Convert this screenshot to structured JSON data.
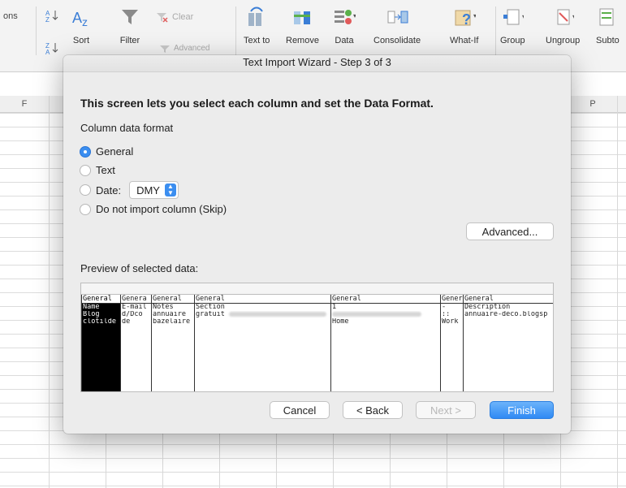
{
  "ribbon": {
    "cut_label": "ons",
    "items": [
      {
        "name": "sort-az",
        "label": ""
      },
      {
        "name": "sort",
        "label": "Sort"
      },
      {
        "name": "filter",
        "label": "Filter"
      },
      {
        "name": "clear",
        "label": "Clear"
      },
      {
        "name": "advanced",
        "label": "Advanced"
      },
      {
        "name": "text-to-columns",
        "label": "Text to"
      },
      {
        "name": "remove-duplicates",
        "label": "Remove"
      },
      {
        "name": "data-validation",
        "label": "Data"
      },
      {
        "name": "consolidate",
        "label": "Consolidate"
      },
      {
        "name": "what-if",
        "label": "What-If"
      },
      {
        "name": "group",
        "label": "Group"
      },
      {
        "name": "ungroup",
        "label": "Ungroup"
      },
      {
        "name": "subtotal",
        "label": "Subto"
      }
    ]
  },
  "sheet": {
    "col_f": "F",
    "col_p": "P"
  },
  "dialog": {
    "title": "Text Import Wizard - Step 3 of 3",
    "heading": "This screen lets you select each column and set the Data Format.",
    "column_format_label": "Column data format",
    "options": {
      "general": "General",
      "text": "Text",
      "date": "Date:",
      "skip": "Do not import column (Skip)"
    },
    "date_format": "DMY",
    "advanced_button": "Advanced...",
    "preview_label": "Preview of selected data:",
    "preview_columns": [
      {
        "header": "General",
        "cells": [
          "Name",
          "Blog",
          "clotilde"
        ]
      },
      {
        "header": "Genera",
        "cells": [
          "E-mail",
          "d/Dco",
          "de"
        ]
      },
      {
        "header": "General",
        "cells": [
          "Notes",
          "annuaire",
          "bazelaire"
        ]
      },
      {
        "header": "General",
        "cells": [
          "Section",
          "gratuit",
          ""
        ]
      },
      {
        "header": "General",
        "cells": [
          "1",
          "",
          "Home"
        ]
      },
      {
        "header": "Gener",
        "cells": [
          "-",
          "::",
          "Work"
        ]
      },
      {
        "header": "General",
        "cells": [
          "Description",
          "annuaire-deco.blogsp",
          ""
        ]
      }
    ],
    "buttons": {
      "cancel": "Cancel",
      "back": "< Back",
      "next": "Next >",
      "finish": "Finish"
    }
  }
}
